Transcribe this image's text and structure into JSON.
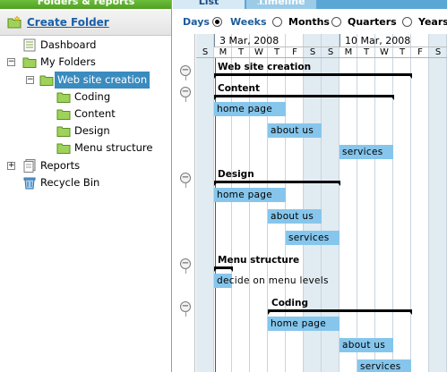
{
  "left_panel": {
    "title": "Folders & reports",
    "create_folder": "Create Folder",
    "tree": {
      "dashboard": "Dashboard",
      "my_folders": "My Folders",
      "website": "Web site creation",
      "coding": "Coding",
      "content": "Content",
      "design": "Design",
      "menu_structure": "Menu structure",
      "reports": "Reports",
      "recycle_bin": "Recycle Bin"
    }
  },
  "right_panel": {
    "tabs": {
      "list": "List",
      "timeline": "Timeline"
    },
    "scale": {
      "days": "Days",
      "weeks": "Weeks",
      "months": "Months",
      "quarters": "Quarters",
      "years": "Years",
      "selected": "weeks"
    },
    "weeks": [
      "3 Mar, 2008",
      "10 Mar, 2008"
    ],
    "day_letters": [
      "S",
      "M",
      "T",
      "W",
      "T",
      "F",
      "S",
      "S",
      "M",
      "T",
      "W",
      "T",
      "F",
      "S"
    ],
    "groups": {
      "website": "Web site creation",
      "content": "Content",
      "design": "Design",
      "menu": "Menu structure",
      "coding": "Coding"
    },
    "tasks": {
      "content_home": "home page",
      "content_about": "about us",
      "content_services": "services",
      "design_home": "home page",
      "design_about": "about us",
      "design_services": "services",
      "menu_decide": "decide on menu levels",
      "coding_home": "home page",
      "coding_about": "about us",
      "coding_services": "services"
    }
  },
  "colors": {
    "left_header": "#5aaa2c",
    "tab_strip": "#5aa7d6",
    "task_bar": "#86c6ec",
    "weekend": "#e1ebf2",
    "today_line": "#a33b1f",
    "selected_tree": "#3a8bbf"
  }
}
